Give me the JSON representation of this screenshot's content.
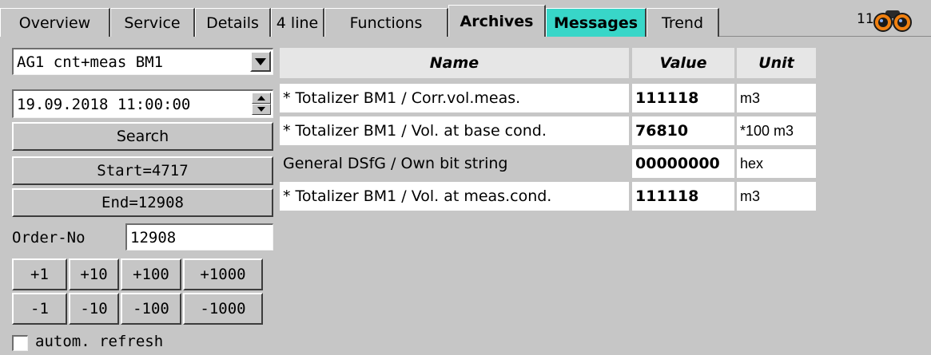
{
  "tabs": [
    {
      "label": "Overview"
    },
    {
      "label": "Service"
    },
    {
      "label": "Details"
    },
    {
      "label": "4 line"
    },
    {
      "label": "Functions"
    },
    {
      "label": "Archives"
    },
    {
      "label": "Messages"
    },
    {
      "label": "Trend"
    }
  ],
  "active_tab": "Archives",
  "clock": "11:",
  "left": {
    "archive_select": "AG1 cnt+meas BM1",
    "datetime": "19.09.2018 11:00:00",
    "search_label": "Search",
    "start_label": "Start=4717",
    "end_label": "End=12908",
    "order_label": "Order-No",
    "order_value": "12908",
    "plus_buttons": [
      "+1",
      "+10",
      "+100",
      "+1000"
    ],
    "minus_buttons": [
      "-1",
      "-10",
      "-100",
      "-1000"
    ],
    "refresh_label": "autom. refresh",
    "refresh_checked": false
  },
  "table": {
    "headers": {
      "name": "Name",
      "value": "Value",
      "unit": "Unit"
    },
    "rows": [
      {
        "name": "* Totalizer BM1 / Corr.vol.meas.",
        "value": "111118",
        "unit": "m3"
      },
      {
        "name": "* Totalizer BM1 / Vol. at base cond.",
        "value": "76810",
        "unit": "*100 m3"
      },
      {
        "name": "General DSfG / Own bit string",
        "value": "00000000",
        "unit": "hex"
      },
      {
        "name": "* Totalizer BM1 / Vol. at meas.cond.",
        "value": "111118",
        "unit": "m3"
      }
    ]
  },
  "colors": {
    "background": "#c6c6c6",
    "messages_tab": "#38d6c8"
  },
  "icons": [
    "binoculars-icon",
    "dropdown-arrow-icon",
    "spin-up-icon",
    "spin-down-icon"
  ]
}
